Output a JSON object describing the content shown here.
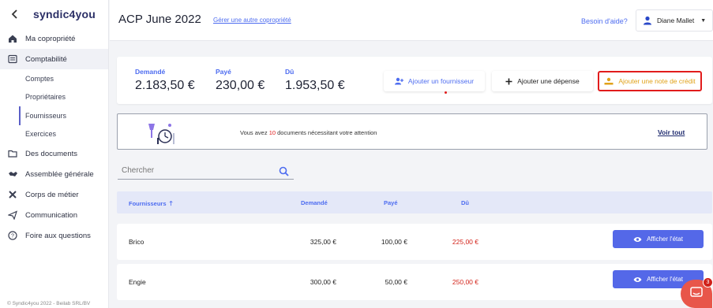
{
  "sidebar": {
    "logo": "syndic4you",
    "items": [
      {
        "label": "Ma copropriété",
        "icon": "home-icon"
      },
      {
        "label": "Comptabilité",
        "icon": "ledger-icon"
      },
      {
        "label": "Des documents",
        "icon": "folder-icon"
      },
      {
        "label": "Assemblée générale",
        "icon": "handshake-icon"
      },
      {
        "label": "Corps de métier",
        "icon": "tools-icon"
      },
      {
        "label": "Communication",
        "icon": "send-icon"
      },
      {
        "label": "Foire aux questions",
        "icon": "question-icon"
      }
    ],
    "sub_items": [
      "Comptes",
      "Propriétaires",
      "Fournisseurs",
      "Exercices"
    ],
    "active_item": "Comptabilité",
    "active_sub_item": "Fournisseurs",
    "footer": "© Syndic4you 2022 - Beilab SRL/BV"
  },
  "header": {
    "title": "ACP June 2022",
    "manage_link": "Gérer une autre copropriété",
    "help_link": "Besoin d'aide?",
    "user_name": "Diane Mallet"
  },
  "summary": {
    "demanded_label": "Demandé",
    "demanded_value": "2.183,50 €",
    "paid_label": "Payé",
    "paid_value": "230,00 €",
    "due_label": "Dû",
    "due_value": "1.953,50 €",
    "add_supplier": "Ajouter un fournisseur",
    "add_expense": "Ajouter une dépense",
    "add_credit_note": "Ajouter une note de crédit"
  },
  "notice": {
    "text_before": "Vous avez ",
    "count": "10",
    "text_after": " documents nécessitant votre attention",
    "link": "Voir tout"
  },
  "search": {
    "placeholder": "Chercher"
  },
  "table": {
    "headers": {
      "supplier": "Fournisseurs",
      "demanded": "Demandé",
      "paid": "Payé",
      "due": "Dû"
    },
    "rows": [
      {
        "name": "Brico",
        "demanded": "325,00 €",
        "paid": "100,00 €",
        "due": "225,00 €",
        "action": "Afficher l'état"
      },
      {
        "name": "Engie",
        "demanded": "300,00 €",
        "paid": "50,00 €",
        "due": "250,00 €",
        "action": "Afficher l'état"
      }
    ]
  },
  "chat": {
    "badge": "3"
  },
  "colors": {
    "accent": "#4d6cf0",
    "primary_button": "#5468e8",
    "due_red": "#d3231a",
    "highlight_border": "#e11c1c",
    "credit_text": "#e0a21a"
  }
}
